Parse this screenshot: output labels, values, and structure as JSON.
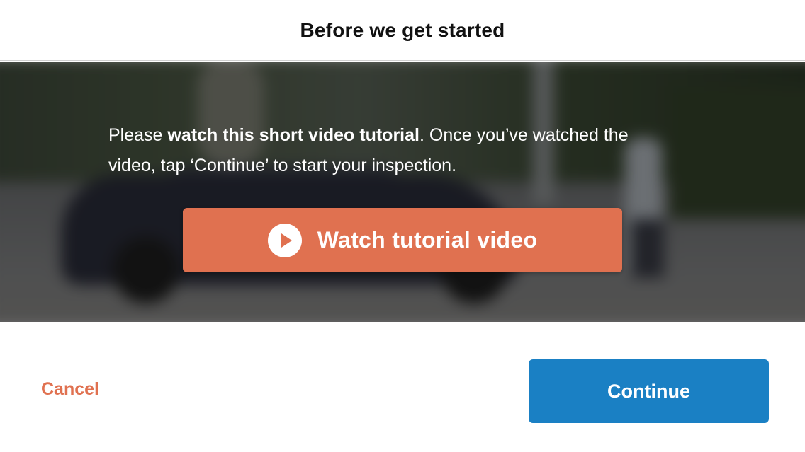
{
  "header": {
    "title": "Before we get started"
  },
  "video_panel": {
    "instructions": {
      "prefix": "Please ",
      "emphasis": "watch this short video tutorial",
      "suffix": ". Once you’ve watched the video, tap ‘Continue’ to start your inspection."
    },
    "watch_button": {
      "label": "Watch tutorial video",
      "icon": "play-icon",
      "color": "#e07150"
    }
  },
  "footer": {
    "cancel_label": "Cancel",
    "continue_label": "Continue",
    "cancel_color": "#e07150",
    "continue_color": "#1a80c4"
  }
}
